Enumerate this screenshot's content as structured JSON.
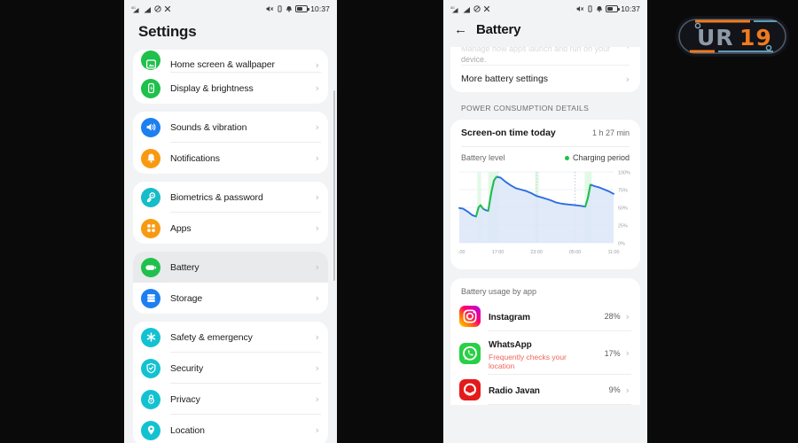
{
  "statusbar": {
    "time": "10:37",
    "icons_left": [
      "signal-4g-icon",
      "signal-bars-icon",
      "mute-icon",
      "bluetooth-off-icon"
    ],
    "icons_right": [
      "sound-off-icon",
      "vibrate-icon",
      "alarm-icon",
      "battery-icon"
    ],
    "battery_level_pct": 62
  },
  "settings": {
    "title": "Settings",
    "groups": [
      {
        "items": [
          {
            "label": "Home screen & wallpaper",
            "icon": "home-wallpaper-icon",
            "color": "#1fc04b",
            "selected": false,
            "clipped": true
          },
          {
            "label": "Display & brightness",
            "icon": "display-brightness-icon",
            "color": "#1fc04b",
            "selected": false
          }
        ]
      },
      {
        "items": [
          {
            "label": "Sounds & vibration",
            "icon": "speaker-icon",
            "color": "#1d7ff0",
            "selected": false
          },
          {
            "label": "Notifications",
            "icon": "bell-icon",
            "color": "#f79a12",
            "selected": false
          }
        ]
      },
      {
        "items": [
          {
            "label": "Biometrics & password",
            "icon": "key-icon",
            "color": "#16bcc8",
            "selected": false
          },
          {
            "label": "Apps",
            "icon": "apps-grid-icon",
            "color": "#f79a12",
            "selected": false
          }
        ]
      },
      {
        "items": [
          {
            "label": "Battery",
            "icon": "battery-icon",
            "color": "#1fc04b",
            "selected": true
          },
          {
            "label": "Storage",
            "icon": "storage-icon",
            "color": "#1d7ff0",
            "selected": false
          }
        ]
      },
      {
        "items": [
          {
            "label": "Safety & emergency",
            "icon": "emergency-star-icon",
            "color": "#13c2d1",
            "selected": false
          },
          {
            "label": "Security",
            "icon": "shield-check-icon",
            "color": "#13c2d1",
            "selected": false
          },
          {
            "label": "Privacy",
            "icon": "privacy-lock-icon",
            "color": "#13c2d1",
            "selected": false
          },
          {
            "label": "Location",
            "icon": "location-pin-icon",
            "color": "#13c2d1",
            "selected": false
          }
        ]
      }
    ],
    "chevron": "›"
  },
  "battery": {
    "header_title": "Battery",
    "back_icon": "back-arrow-icon",
    "clipped_item": {
      "line1": "Manage how apps launch and run on your",
      "line2": "device."
    },
    "more_settings_label": "More battery settings",
    "section_head": "POWER CONSUMPTION DETAILS",
    "screen_on_time_label": "Screen-on time today",
    "screen_on_time_value": "1 h 27 min",
    "legend_level": "Battery level",
    "legend_charging": "Charging period",
    "legend_charging_color": "#22c04a",
    "apps_head": "Battery usage by app",
    "apps": [
      {
        "name": "Instagram",
        "pct": "28%",
        "icon": "instagram-icon",
        "warning": ""
      },
      {
        "name": "WhatsApp",
        "pct": "17%",
        "icon": "whatsapp-icon",
        "warning": "Frequently checks your location"
      },
      {
        "name": "Radio Javan",
        "pct": "9%",
        "icon": "radiojavan-icon",
        "warning": ""
      }
    ],
    "chevron": "›"
  },
  "chart_data": {
    "type": "area",
    "title": "Battery level",
    "xlabel": "",
    "ylabel": "",
    "ylim": [
      0,
      100
    ],
    "grid": true,
    "legend_position": "top-right",
    "yticks": [
      "0%",
      "25%",
      "50%",
      "75%",
      "100%"
    ],
    "ytick_values": [
      0,
      25,
      50,
      75,
      100
    ],
    "xticks": [
      "11:00",
      "17:00",
      "23:00",
      "05:00",
      "11:00"
    ],
    "xtick_values": [
      0,
      6,
      12,
      18,
      24
    ],
    "series": [
      {
        "name": "Battery level",
        "color": "#2b6fe0",
        "fill": "#dce6f8",
        "x": [
          0,
          0.6,
          1.3,
          2.0,
          2.6,
          3.0,
          3.3,
          3.7,
          4.1,
          4.5,
          5.0,
          5.4,
          5.8,
          6.4,
          7.2,
          8.0,
          8.8,
          9.6,
          10.4,
          11.2,
          12.0,
          12.8,
          13.5,
          14.2,
          15.0,
          16.0,
          17.0,
          18.0,
          19.0,
          19.6,
          20.0,
          20.4,
          21.0,
          21.8,
          22.6,
          23.4,
          24.0
        ],
        "y": [
          49,
          48,
          44,
          39,
          37,
          50,
          53,
          48,
          46,
          45,
          72,
          88,
          93,
          92,
          86,
          81,
          77,
          75,
          73,
          70,
          66,
          64,
          62,
          60,
          57,
          55,
          54,
          53,
          52,
          51,
          63,
          82,
          80,
          78,
          75,
          72,
          69
        ]
      }
    ],
    "charging_periods": [
      {
        "start": 2.8,
        "end": 3.4,
        "color": "#22c04a"
      },
      {
        "start": 4.5,
        "end": 5.9,
        "color": "#22c04a"
      },
      {
        "start": 11.8,
        "end": 12.4,
        "color": "#22c04a"
      },
      {
        "start": 19.5,
        "end": 20.6,
        "color": "#22c04a"
      }
    ]
  },
  "watermark": {
    "text_primary": "UR",
    "text_accent": "19",
    "color_primary": "#8d9aa5",
    "color_accent": "#f07a1e"
  }
}
